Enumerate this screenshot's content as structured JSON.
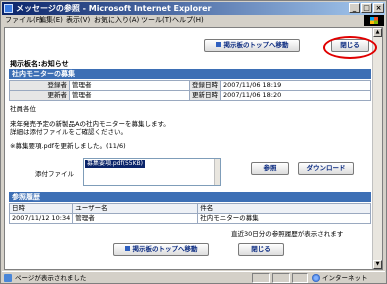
{
  "window": {
    "title": "メッセージの参照 - Microsoft Internet Explorer",
    "menu": [
      "ファイル(F)",
      "編集(E)",
      "表示(V)",
      "お気に入り(A)",
      "ツール(T)",
      "ヘルプ(H)"
    ]
  },
  "toolbar": {
    "top_button": "掲示板のトップへ移動",
    "close_button": "閉じる"
  },
  "board_name": "掲示板名:お知らせ",
  "message": {
    "title": "社内モニターの募集",
    "registrant_label": "登録者",
    "registrant": "管理者",
    "registered_label": "登録日時",
    "registered": "2007/11/06 18:19",
    "updater_label": "更新者",
    "updater": "管理者",
    "updated_label": "更新日時",
    "updated": "2007/11/06 18:20",
    "body": [
      "社員各位",
      "",
      "来年発売予定の新製品Aの社内モニターを募集します。",
      "詳細は添付ファイルをご確認ください。",
      "",
      "※募集要項.pdfを更新しました。(11/6)"
    ],
    "attach_label": "添付ファイル",
    "attach_file": "募集要項.pdf(55KB)",
    "browse_button": "参照",
    "download_button": "ダウンロード"
  },
  "history": {
    "title": "参照履歴",
    "columns": [
      "日時",
      "ユーザー名",
      "件名"
    ],
    "rows": [
      [
        "2007/11/12 10:34",
        "管理者",
        "社内モニターの募集"
      ]
    ],
    "note": "直近30日分の参照履歴が表示されます"
  },
  "bottom": {
    "top_button": "掲示板のトップへ移動",
    "close_button": "閉じる"
  },
  "status": {
    "text": "ページが表示されました",
    "zone": "インターネット"
  },
  "colors": {
    "section_header": "#3d6fb5",
    "highlight_circle": "#e00000",
    "titlebar_start": "#0a246a"
  }
}
